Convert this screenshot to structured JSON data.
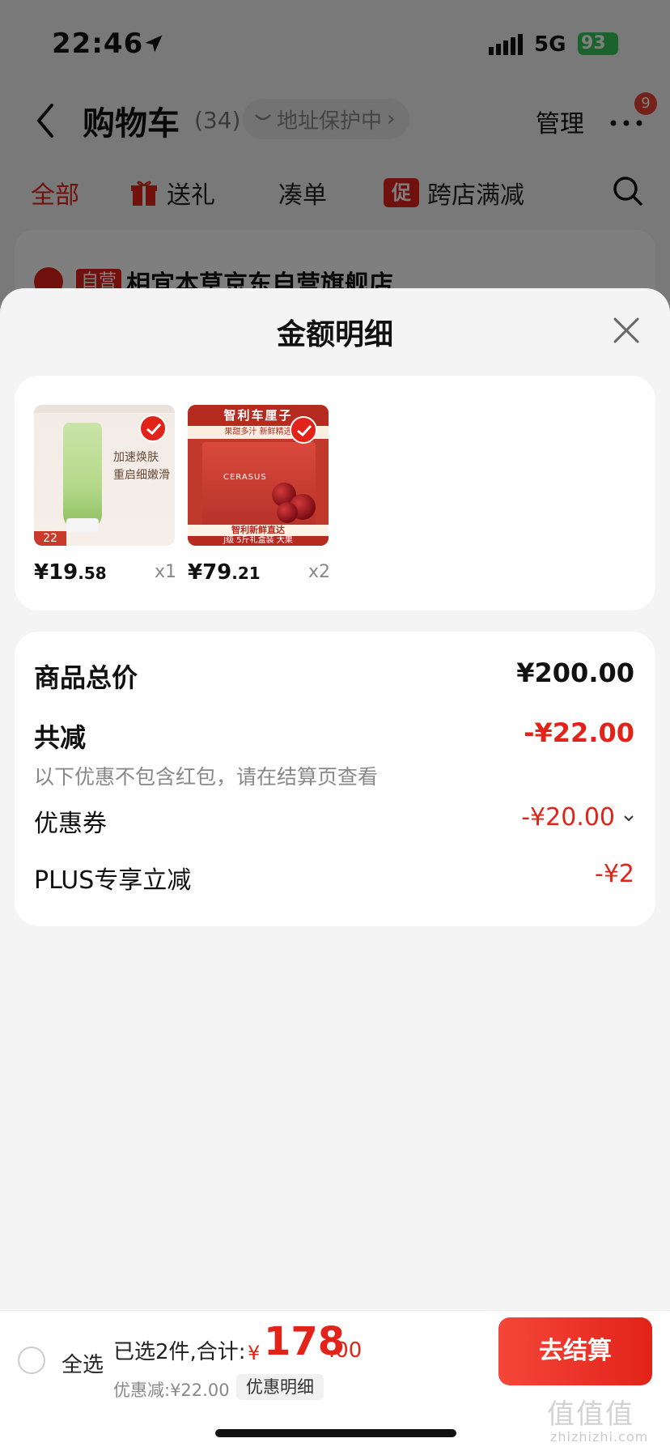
{
  "status_bar": {
    "time": "22:46",
    "network": "5G",
    "battery": "93"
  },
  "nav": {
    "title": "购物车",
    "count": "(34)",
    "address_pill": "地址保护中",
    "manage": "管理",
    "more_badge": "9"
  },
  "filters": [
    {
      "label": "全部",
      "active": true
    },
    {
      "label": "送礼",
      "icon": "gift-icon"
    },
    {
      "label": "凑单"
    },
    {
      "label": "跨店满减",
      "tag": "促"
    }
  ],
  "store": {
    "tag": "自营",
    "name": "相宜本草京东自营旗舰店"
  },
  "sheet": {
    "title": "金额明细"
  },
  "items": [
    {
      "price_int": "¥19",
      "price_dec": ".58",
      "qty": "x1",
      "image_texts": {
        "line1": "加速焕肤",
        "line2": "重启细嫩滑",
        "badge": "22"
      }
    },
    {
      "price_int": "¥79",
      "price_dec": ".21",
      "qty": "x2",
      "image_texts": {
        "header": "智利车厘子",
        "sub": "果甜多汁 新鲜精选",
        "brand": "CERASUS",
        "foot1": "智利新鲜直达",
        "foot2": "J级 5斤礼盒装 大果"
      }
    }
  ],
  "summary": {
    "total_label": "商品总价",
    "total_value": "¥200.00",
    "reduce_label": "共减",
    "reduce_value": "-¥22.00",
    "reduce_note": "以下优惠不包含红包，请在结算页查看",
    "coupon_label": "优惠券",
    "coupon_value": "-¥20.00",
    "plus_label": "PLUS专享立减",
    "plus_value": "-¥2"
  },
  "bottom": {
    "select_all": "全选",
    "selected_text": "已选2件,合计:",
    "currency": "¥",
    "total_int": "178",
    "total_dec": ".00",
    "discount_text": "优惠减:¥22.00",
    "detail_button": "优惠明细",
    "checkout": "去结算"
  },
  "watermark": {
    "main": "值值值",
    "sub": "zhizhizhi.com"
  },
  "colors": {
    "accent": "#e2231a",
    "background": "#f4f4f4",
    "card": "#ffffff"
  }
}
